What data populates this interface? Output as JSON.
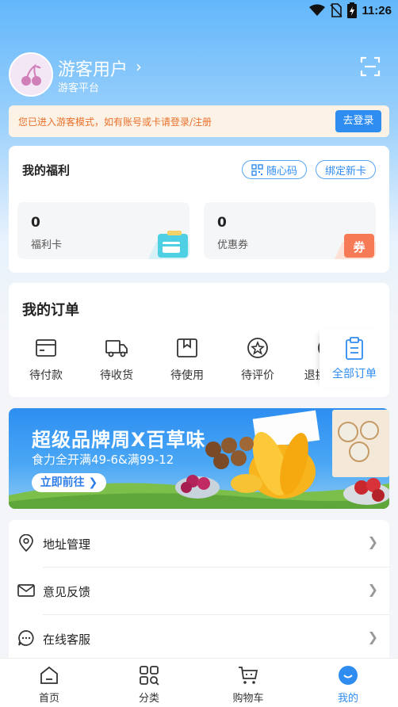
{
  "status_bar": {
    "time": "11:26"
  },
  "profile": {
    "name": "游客用户",
    "chevron": "›",
    "subtitle": "游客平台"
  },
  "notice": {
    "text": "您已进入游客模式，如有账号或卡请登录/注册",
    "login_label": "去登录"
  },
  "welfare": {
    "title": "我的福利",
    "qr_label": "随心码",
    "bind_label": "绑定新卡",
    "cards": [
      {
        "count": "0",
        "label": "福利卡",
        "icon": "card-icon"
      },
      {
        "count": "0",
        "label": "优惠券",
        "icon": "coupon-icon",
        "icon_text": "券"
      }
    ]
  },
  "orders": {
    "title": "我的订单",
    "items": [
      {
        "label": "待付款",
        "icon": "wallet-icon"
      },
      {
        "label": "待收货",
        "icon": "truck-icon"
      },
      {
        "label": "待使用",
        "icon": "box-icon"
      },
      {
        "label": "待评价",
        "icon": "star-icon"
      },
      {
        "label": "退换/售后",
        "icon": "yen-icon"
      }
    ],
    "all_label": "全部订单"
  },
  "banner": {
    "title": "超级品牌周X百草味",
    "subtitle": "食力全开满49-6&满99-12",
    "button": "立即前往 ❯",
    "colors": {
      "primary": "#2d8ef1"
    }
  },
  "menu": [
    {
      "label": "地址管理",
      "icon": "location-icon"
    },
    {
      "label": "意见反馈",
      "icon": "mail-icon"
    },
    {
      "label": "在线客服",
      "icon": "chat-icon"
    }
  ],
  "tabbar": [
    {
      "label": "首页",
      "icon": "home-icon"
    },
    {
      "label": "分类",
      "icon": "category-icon"
    },
    {
      "label": "购物车",
      "icon": "cart-icon"
    },
    {
      "label": "我的",
      "icon": "profile-icon",
      "active": true
    }
  ],
  "colors": {
    "accent": "#2f8cf0",
    "notice_text": "#e8702a",
    "notice_bg": "#fdf2e6"
  }
}
